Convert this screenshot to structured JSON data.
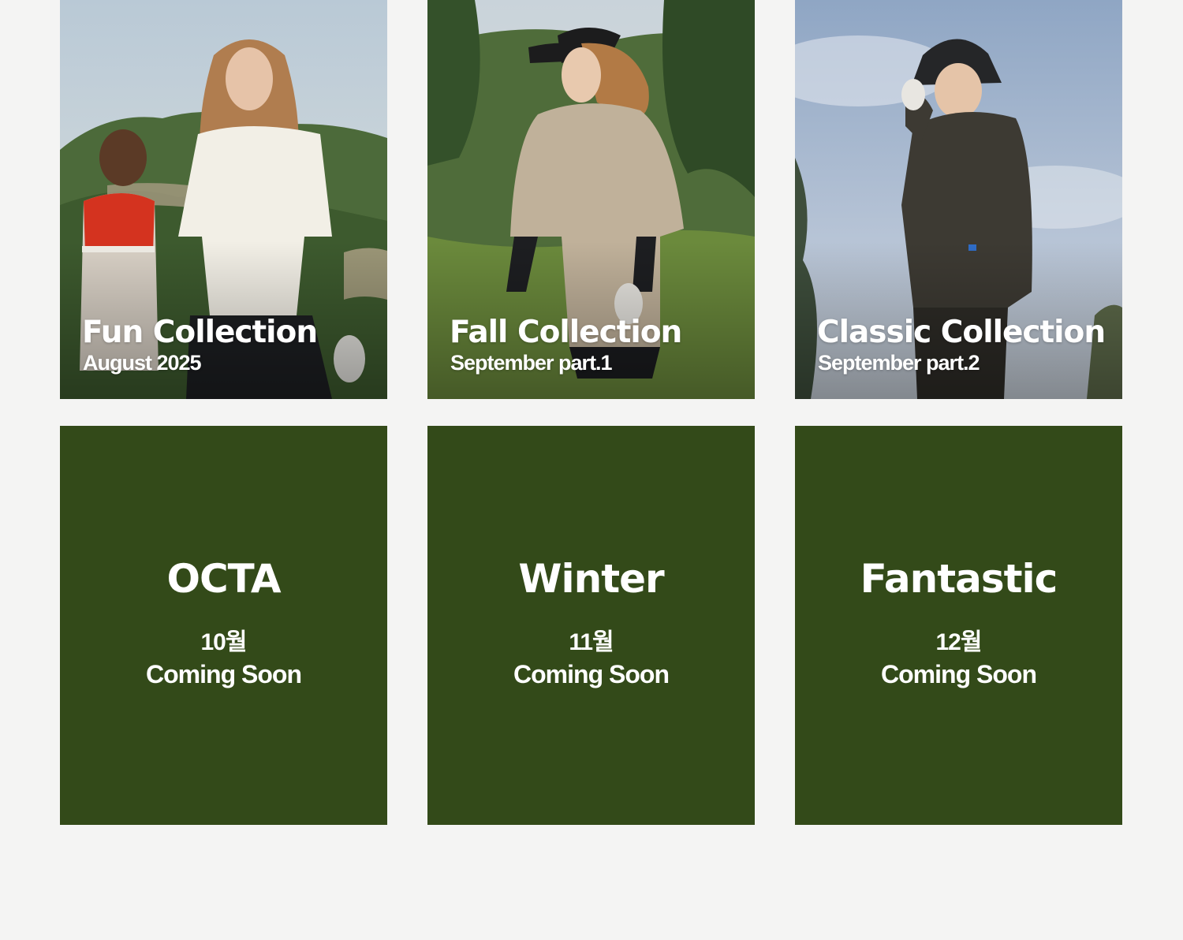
{
  "collections": [
    {
      "title": "Fun Collection",
      "subtitle": "August 2025",
      "photo": "golf-couple-photo"
    },
    {
      "title": "Fall Collection",
      "subtitle": "September part.1",
      "photo": "golf-woman-visor-photo"
    },
    {
      "title": "Classic Collection",
      "subtitle": "September part.2",
      "photo": "golf-man-bucket-hat-photo"
    }
  ],
  "upcoming": [
    {
      "name": "OCTA",
      "month": "10월",
      "status": "Coming Soon"
    },
    {
      "name": "Winter",
      "month": "11월",
      "status": "Coming Soon"
    },
    {
      "name": "Fantastic",
      "month": "12월",
      "status": "Coming Soon"
    }
  ],
  "colors": {
    "page_background": "#f4f4f3",
    "card_green": "#334a19",
    "text": "#ffffff"
  }
}
